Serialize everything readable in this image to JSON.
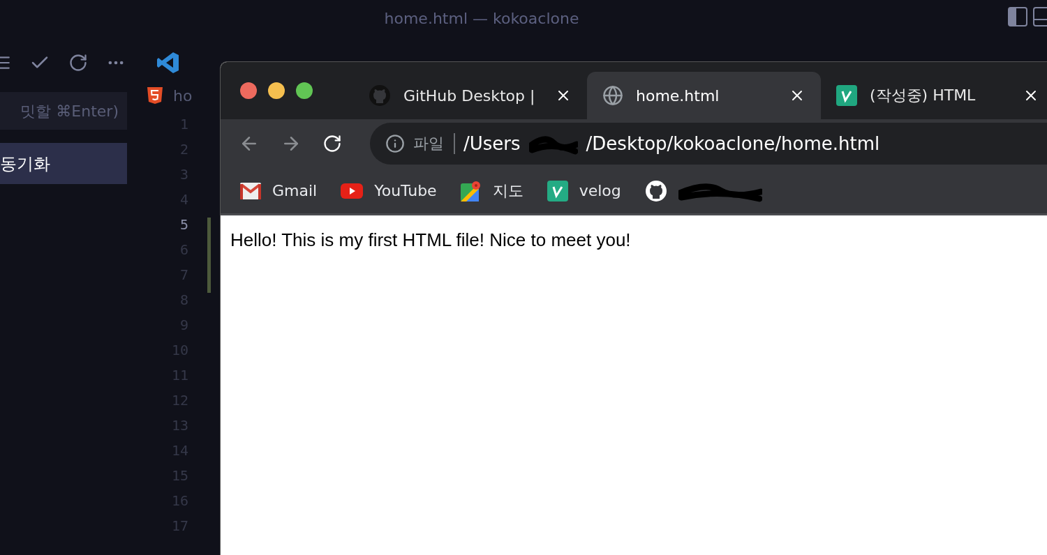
{
  "vscode": {
    "title": "home.html — kokoaclone",
    "commit_input": {
      "placeholder": "밋할 ⌘Enter)"
    },
    "sync_button": "동기화",
    "breadcrumb": "ho",
    "line_numbers": [
      {
        "number": "1",
        "selected": false
      },
      {
        "number": "2",
        "selected": false
      },
      {
        "number": "3",
        "selected": false
      },
      {
        "number": "4",
        "selected": false
      },
      {
        "number": "5",
        "selected": true
      },
      {
        "number": "6",
        "selected": false
      },
      {
        "number": "7",
        "selected": false
      },
      {
        "number": "8",
        "selected": false
      },
      {
        "number": "9",
        "selected": false
      },
      {
        "number": "10",
        "selected": false
      },
      {
        "number": "11",
        "selected": false
      },
      {
        "number": "12",
        "selected": false
      },
      {
        "number": "13",
        "selected": false
      },
      {
        "number": "14",
        "selected": false
      },
      {
        "number": "15",
        "selected": false
      },
      {
        "number": "16",
        "selected": false
      },
      {
        "number": "17",
        "selected": false
      }
    ]
  },
  "browser": {
    "tabs": [
      {
        "title": "GitHub Desktop |",
        "kind": "github",
        "selected": false
      },
      {
        "title": "home.html",
        "kind": "globe",
        "selected": true
      },
      {
        "title": "(작성중) HTML",
        "kind": "velog",
        "selected": false
      }
    ],
    "address": {
      "scheme_label": "파일",
      "path_start": "/Users",
      "path_end": "/Desktop/kokoaclone/home.html"
    },
    "bookmarks": [
      {
        "label": "Gmail",
        "kind": "gmail"
      },
      {
        "label": "YouTube",
        "kind": "youtube"
      },
      {
        "label": "지도",
        "kind": "maps"
      },
      {
        "label": "velog",
        "kind": "velog"
      },
      {
        "kind": "github"
      }
    ],
    "page_text": "Hello! This is my first HTML file! Nice to meet you!"
  }
}
